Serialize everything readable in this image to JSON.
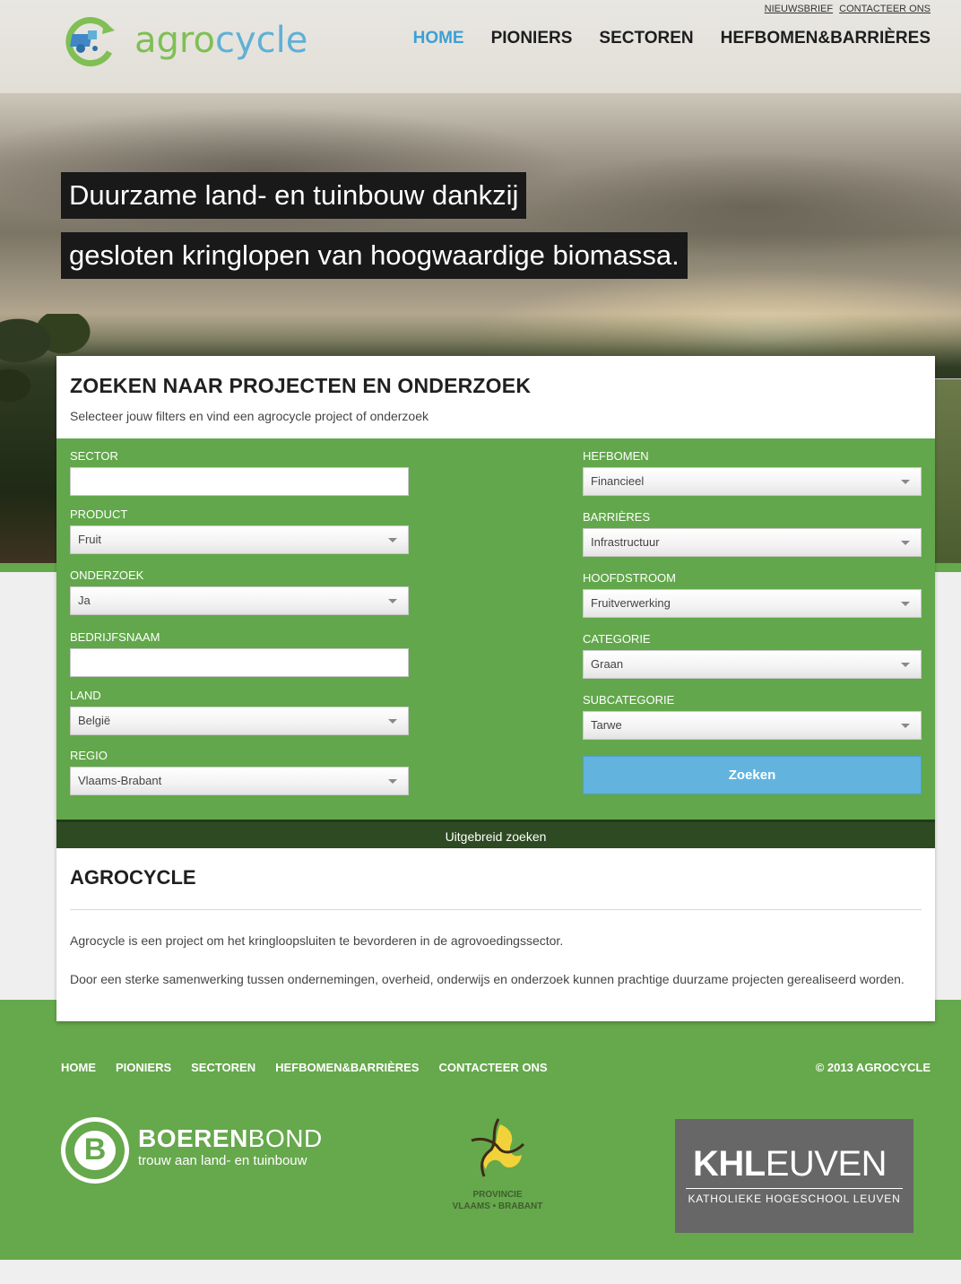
{
  "brand": {
    "name_part1": "agro",
    "name_part2": "cycle",
    "icon": "recycle-tractor-icon"
  },
  "util_links": [
    "NIEUWSBRIEF",
    "CONTACTEER ONS"
  ],
  "nav": [
    {
      "label": "HOME",
      "active": true
    },
    {
      "label": "PIONIERS",
      "active": false
    },
    {
      "label": "SECTOREN",
      "active": false
    },
    {
      "label": "HEFBOMEN&BARRIÈRES",
      "active": false
    }
  ],
  "hero": {
    "line1": "Duurzame land- en tuinbouw dankzij",
    "line2": "gesloten kringlopen van hoogwaardige biomassa."
  },
  "search": {
    "title": "ZOEKEN NAAR PROJECTEN EN ONDERZOEK",
    "subtitle": "Selecteer jouw filters en vind een agrocycle project of onderzoek",
    "left": [
      {
        "label": "SECTOR",
        "value": "",
        "type": "input"
      },
      {
        "label": "PRODUCT",
        "value": "Fruit",
        "type": "select"
      },
      {
        "label": "ONDERZOEK",
        "value": "Ja",
        "type": "select"
      },
      {
        "label": "BEDRIJFSNAAM",
        "value": "",
        "type": "input"
      },
      {
        "label": "LAND",
        "value": "België",
        "type": "select"
      },
      {
        "label": "REGIO",
        "value": "Vlaams-Brabant",
        "type": "select"
      }
    ],
    "right": [
      {
        "label": "HEFBOMEN",
        "value": "Financieel",
        "type": "select"
      },
      {
        "label": "BARRIÈRES",
        "value": "Infrastructuur",
        "type": "select"
      },
      {
        "label": "HOOFDSTROOM",
        "value": "Fruitverwerking",
        "type": "select"
      },
      {
        "label": "CATEGORIE",
        "value": "Graan",
        "type": "select"
      },
      {
        "label": "SUBCATEGORIE",
        "value": "Tarwe",
        "type": "select"
      }
    ],
    "button": "Zoeken",
    "advanced": "Uitgebreid zoeken"
  },
  "about": {
    "title": "AGROCYCLE",
    "p1": "Agrocycle is een project om het kringloopsluiten te bevorderen in de agrovoedingssector.",
    "p2": "Door een sterke samenwerking tussen ondernemingen, overheid, onderwijs en onderzoek kunnen prachtige duurzame projecten gerealiseerd worden."
  },
  "footer": {
    "nav": [
      "HOME",
      "PIONIERS",
      "SECTOREN",
      "HEFBOMEN&BARRIÈRES",
      "CONTACTEER ONS"
    ],
    "copyright": "© 2013 AGROCYCLE"
  },
  "partners": {
    "boerenbond": {
      "letter": "B",
      "name_bold": "BOEREN",
      "name_light": "BOND",
      "tagline": "trouw aan land- en tuinbouw"
    },
    "provincie": {
      "line1": "PROVINCIE",
      "line2": "VLAAMS • BRABANT"
    },
    "khleuven": {
      "bold": "KHL",
      "light": "EUVEN",
      "sub": "KATHOLIEKE HOGESCHOOL LEUVEN"
    }
  },
  "colors": {
    "green": "#66a84c",
    "blue": "#3da0d4",
    "button": "#62b4de",
    "dark_green": "#2d4a22"
  }
}
